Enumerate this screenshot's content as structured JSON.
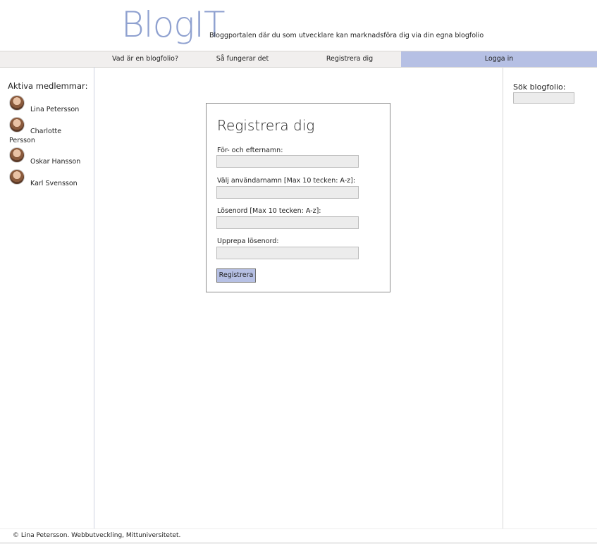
{
  "header": {
    "logo": "BlogIT",
    "tagline": "Bloggportalen där du som utvecklare kan marknadsföra dig via din egna blogfolio"
  },
  "nav": {
    "items": [
      {
        "label": "Vad är en blogfolio?"
      },
      {
        "label": "Så fungerar det"
      },
      {
        "label": "Registrera dig"
      },
      {
        "label": "Logga in"
      }
    ],
    "active_index": 3,
    "active_color": "#b6c0e4"
  },
  "sidebar": {
    "title": "Aktiva medlemmar:",
    "members": [
      {
        "name": "Lina Petersson",
        "icon": "avatar-photo"
      },
      {
        "name": "Charlotte Persson",
        "icon": "avatar-photo"
      },
      {
        "name": "Oskar Hansson",
        "icon": "avatar-photo"
      },
      {
        "name": "Karl Svensson",
        "icon": "avatar-photo"
      }
    ]
  },
  "search": {
    "label": "Sök blogfolio:",
    "value": ""
  },
  "form": {
    "title": "Registrera dig",
    "fields": [
      {
        "label": "För- och efternamn:",
        "value": ""
      },
      {
        "label": "Välj användarnamn [Max 10 tecken: A-z]:",
        "value": ""
      },
      {
        "label": "Lösenord [Max 10 tecken: A-z]:",
        "value": ""
      },
      {
        "label": "Upprepa lösenord:",
        "value": ""
      }
    ],
    "submit_label": "Registrera"
  },
  "footer": {
    "text": "© Lina Petersson. Webbutveckling, Mittuniversitetet."
  },
  "colors": {
    "brand": "#8fa1d0",
    "accent": "#b6c0e4",
    "nav_bg": "#f1efee",
    "input_bg": "#ececec"
  }
}
